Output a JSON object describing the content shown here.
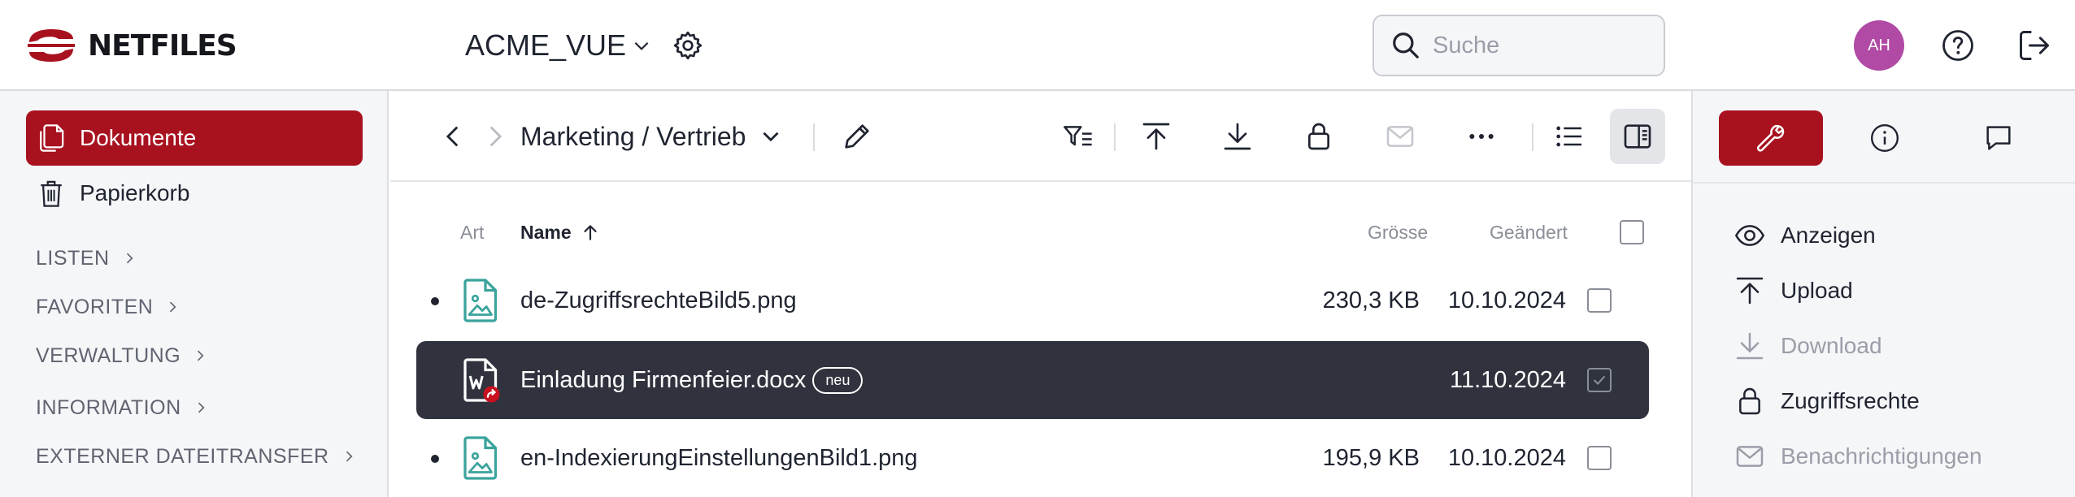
{
  "header": {
    "brand": "NETFILES",
    "workspace": "ACME_VUE",
    "search_placeholder": "Suche",
    "avatar_initials": "AH"
  },
  "sidebar": {
    "items": [
      {
        "label": "Dokumente",
        "active": true
      },
      {
        "label": "Papierkorb",
        "active": false
      }
    ],
    "sections": [
      "LISTEN",
      "FAVORITEN",
      "VERWALTUNG",
      "INFORMATION",
      "EXTERNER DATEITRANSFER"
    ]
  },
  "toolbar": {
    "path": "Marketing / Vertrieb"
  },
  "table": {
    "columns": {
      "type": "Art",
      "name": "Name",
      "size": "Grösse",
      "modified": "Geändert"
    },
    "rows": [
      {
        "name": "de-ZugriffsrechteBild5.png",
        "size": "230,3 KB",
        "date": "10.10.2024",
        "type": "image",
        "selected": false,
        "badge": ""
      },
      {
        "name": "Einladung Firmenfeier.docx",
        "size": "",
        "date": "11.10.2024",
        "type": "word",
        "selected": true,
        "badge": "neu"
      },
      {
        "name": "en-IndexierungEinstellungenBild1.png",
        "size": "195,9 KB",
        "date": "10.10.2024",
        "type": "image",
        "selected": false,
        "badge": ""
      }
    ]
  },
  "panel": {
    "actions": [
      {
        "label": "Anzeigen",
        "icon": "eye-icon",
        "enabled": true
      },
      {
        "label": "Upload",
        "icon": "upload-icon",
        "enabled": true
      },
      {
        "label": "Download",
        "icon": "download-icon",
        "enabled": false
      },
      {
        "label": "Zugriffsrechte",
        "icon": "lock-icon",
        "enabled": true
      },
      {
        "label": "Benachrichtigungen",
        "icon": "mail-icon",
        "enabled": false
      }
    ]
  },
  "colors": {
    "brand": "#a8121f",
    "avatar": "#b04aa5",
    "selected_row": "#30333d",
    "file_icon": "#3aa39c"
  }
}
